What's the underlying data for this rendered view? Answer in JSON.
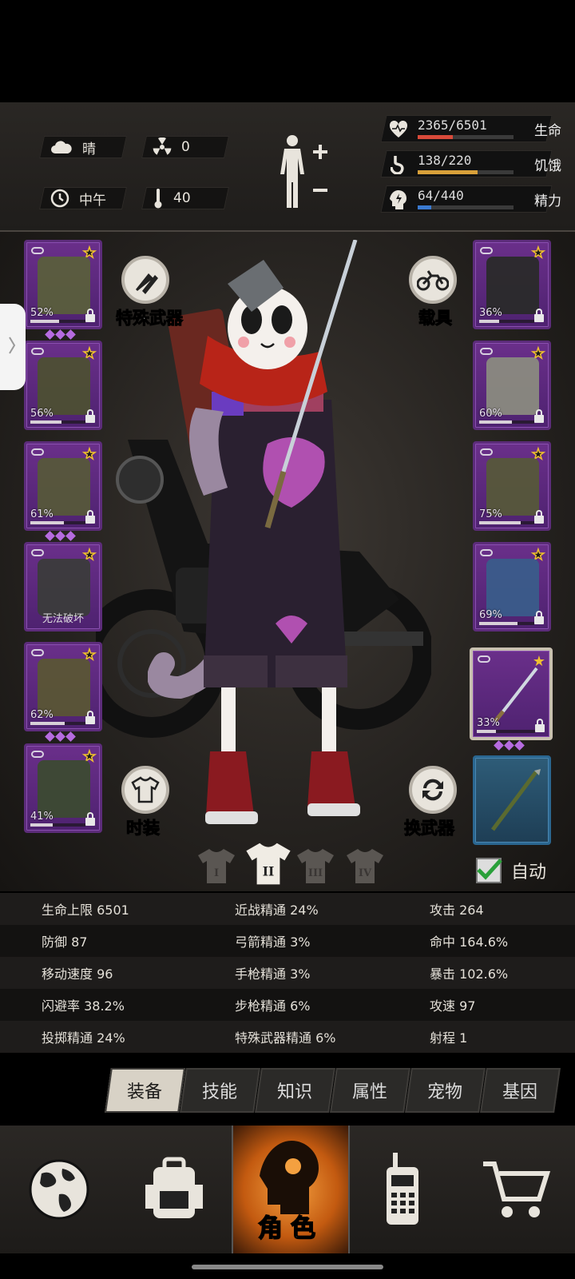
{
  "hud": {
    "weather": "晴",
    "radiation": "0",
    "time_of_day": "中午",
    "temperature": "40",
    "stats": [
      {
        "name": "health",
        "text": "2365/6501",
        "label": "生命",
        "fill": 0.364,
        "color": "#d94a3a"
      },
      {
        "name": "hunger",
        "text": "138/220",
        "label": "饥饿",
        "fill": 0.627,
        "color": "#d8a03a"
      },
      {
        "name": "energy",
        "text": "64/440",
        "label": "精力",
        "fill": 0.145,
        "color": "#3a7ad0"
      }
    ]
  },
  "left_slots": [
    {
      "name": "helmet",
      "pct": "52%",
      "durability": 0.52,
      "gems": 3,
      "art": "#5a5e3c",
      "icon": "helmet-icon"
    },
    {
      "name": "vest",
      "pct": "56%",
      "durability": 0.56,
      "gems": 0,
      "art": "#4d4f33",
      "icon": "vest-icon"
    },
    {
      "name": "suit",
      "pct": "61%",
      "durability": 0.61,
      "gems": 3,
      "art": "#56573a",
      "icon": "camo-suit-icon"
    },
    {
      "name": "backpack",
      "broken_text": "无法破坏",
      "art": "#3b3b3b",
      "icon": "backpack-icon"
    },
    {
      "name": "pants",
      "pct": "62%",
      "durability": 0.62,
      "gems": 3,
      "art": "#5a5535",
      "icon": "pants-icon"
    },
    {
      "name": "boots",
      "pct": "41%",
      "durability": 0.41,
      "gems": 0,
      "art": "#3c4a32",
      "icon": "boots-icon"
    }
  ],
  "right_slots": [
    {
      "name": "goggles",
      "pct": "36%",
      "durability": 0.36,
      "art": "#2a2a2a",
      "icon": "goggles-icon"
    },
    {
      "name": "gas-mask",
      "pct": "60%",
      "durability": 0.6,
      "art": "#8a8a80",
      "icon": "gas-mask-icon"
    },
    {
      "name": "armor",
      "pct": "75%",
      "durability": 0.75,
      "art": "#56573a",
      "icon": "armor-vest-icon"
    },
    {
      "name": "accessory",
      "pct": "69%",
      "durability": 0.69,
      "art": "#3a5c8a",
      "icon": "pouch-icon"
    }
  ],
  "weapon_slot": {
    "pct": "33%",
    "durability": 0.33,
    "gems": 3
  },
  "buttons": {
    "special_weapon": "特殊武器",
    "vehicle": "载具",
    "fashion": "时装",
    "swap_weapon": "换武器",
    "auto": "自动"
  },
  "outfit_tabs": [
    "I",
    "II",
    "III",
    "IV"
  ],
  "stats_rows": [
    [
      "生命上限 6501",
      "近战精通 24%",
      "攻击 264"
    ],
    [
      "防御 87",
      "弓箭精通 3%",
      "命中 164.6%"
    ],
    [
      "移动速度 96",
      "手枪精通 3%",
      "暴击 102.6%"
    ],
    [
      "闪避率 38.2%",
      "步枪精通 6%",
      "攻速 97"
    ],
    [
      "投掷精通 24%",
      "特殊武器精通 6%",
      "射程 1"
    ]
  ],
  "tabs": [
    "装备",
    "技能",
    "知识",
    "属性",
    "宠物",
    "基因"
  ],
  "nav": {
    "items": [
      "world-map-icon",
      "backpack-icon",
      "character-icon",
      "radio-icon",
      "shop-cart-icon"
    ],
    "active_label": "角色"
  }
}
